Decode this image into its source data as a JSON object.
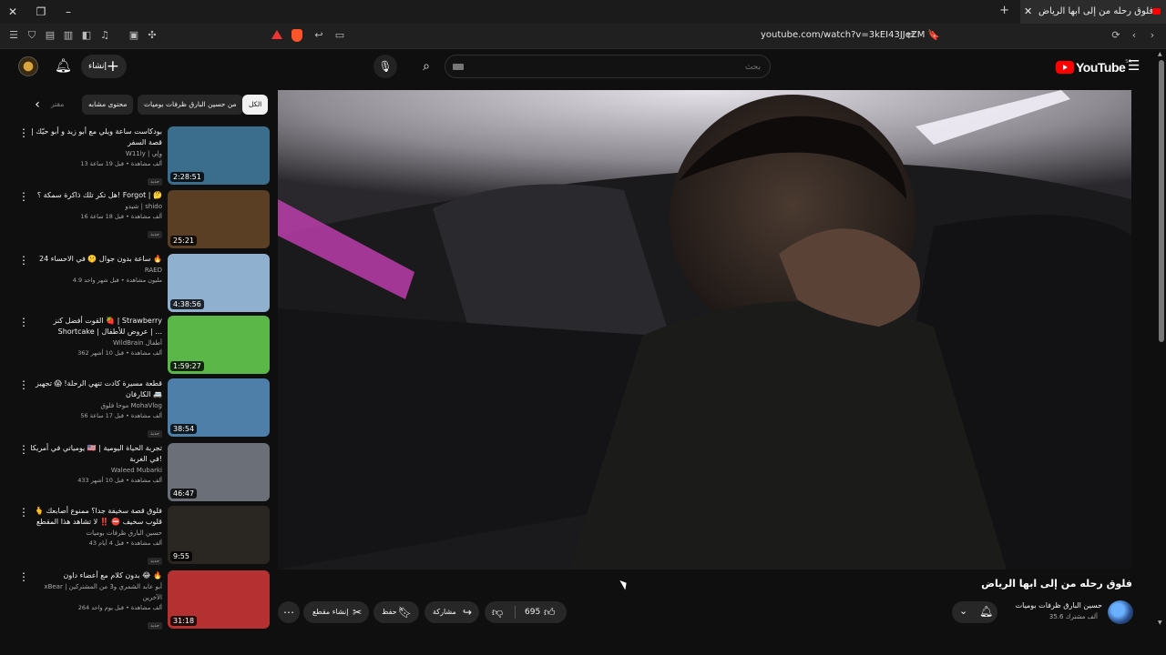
{
  "browser": {
    "tab_title": "فلوق رحله من إلى ابها الرياض",
    "url": "youtube.com/watch?v=3kEI43JJeZM",
    "new_tab": "+",
    "close": "✕"
  },
  "header": {
    "create_label": "إنشاء",
    "search_placeholder": "بحث",
    "logo_text": "YouTube",
    "country_code": "SA"
  },
  "chips": {
    "items": [
      "الكل",
      "من حسين البارق ظرفات بوميات",
      "محتوى مشابه",
      "مقتر"
    ]
  },
  "recommendations": [
    {
      "title": "بودكاست ساعة ويلي مع أبو زيد و أبو حيّك | قصة السفر",
      "channel": "W11ly | وِلِي",
      "meta": "13 ألف مشاهدة • قبل 19 ساعة",
      "badge": "جديد",
      "duration": "2:28:51",
      "color": "#3b6d8c"
    },
    {
      "title": "هل تكر تلك ذاكرة سمكة ؟! Forgot | 🤔",
      "channel": "شيدو | shido",
      "meta": "16 ألف مشاهدة • قبل 18 ساعة",
      "badge": "جديد",
      "duration": "25:21",
      "color": "#5a3f25"
    },
    {
      "title": "24 ساعة بدون جوال 🤫 في الاحساء 🔥",
      "channel": "RAED",
      "meta": "4.9 مليون مشاهدة • قبل شهر واحد",
      "badge": "",
      "duration": "4:38:56",
      "color": "#8fb0cf"
    },
    {
      "title": "القوت أفضل كنز 🍓 | Strawberry Shortcake | عروض للأطفال | ...",
      "channel": "WildBrain أطفال",
      "meta": "362 ألف مشاهدة • قبل 10 أشهر",
      "badge": "",
      "duration": "1:59:27",
      "color": "#5bb848"
    },
    {
      "title": "قطعة مسيرة كادت تنهي الرحلة! 😱 تجهيز الكارفان 🚐",
      "channel": "موحا فلوق MohaVlog",
      "meta": "56 ألف مشاهدة • قبل 17 ساعة",
      "badge": "جديد",
      "duration": "38:54",
      "color": "#4d7fa8"
    },
    {
      "title": "يومياتي في أمريكا 🇺🇸 | تجربة الحياة اليومية في الغربة!",
      "channel": "Waleed Mubarki",
      "meta": "433 ألف مشاهدة • قبل 10 أشهر",
      "badge": "",
      "duration": "46:47",
      "color": "#6a6f78"
    },
    {
      "title": "فلوق قصة سخيفة جدا؟ ممنوع أصابعك 🫰 قلوب سخيف ⛔ ‼️ لا تشاهد هذا المقطع",
      "channel": "حسين البارق ظرفات بوميات",
      "meta": "43 ألف مشاهدة • قبل 4 أيام",
      "badge": "جديد",
      "duration": "9:55",
      "color": "#2a2622"
    },
    {
      "title": "بدون كلام مع أعضاء داون 😂 🔥",
      "channel": "xBear | أبو عابد الشمري و3 من المشتركين الآخرين",
      "meta": "264 ألف مشاهدة • قبل يوم واحد",
      "badge": "جديد",
      "duration": "31:18",
      "color": "#b53030"
    }
  ],
  "video": {
    "title": "فلوق رحله من إلى ابها الرياض",
    "channel": "حسين البارق ظرفات بوميات",
    "subscribers": "35.6 ألف مشترك",
    "likes": "695",
    "share_label": "مشاركة",
    "save_label": "حفظ",
    "clip_label": "إنشاء مقطع"
  },
  "icons": {
    "more": "⋮",
    "bell": "🔔",
    "chevron_left": "‹",
    "chevron_down": "⌄"
  },
  "colors": {
    "accent": "#ff0000",
    "background": "#0f0f0f"
  }
}
